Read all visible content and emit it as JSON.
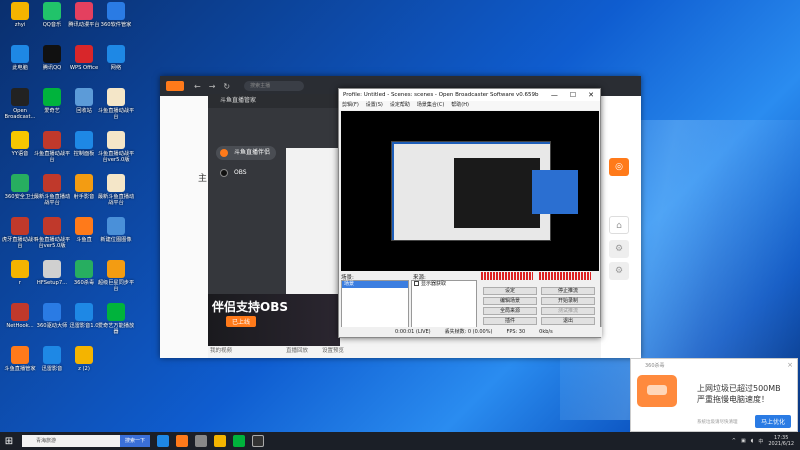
{
  "desktop_icons": [
    {
      "label": "zhyi",
      "color": "#f4b400",
      "icon": "folder-icon"
    },
    {
      "label": "QQ音乐",
      "color": "#21c36a",
      "icon": "music-icon"
    },
    {
      "label": "腾讯动漫平台",
      "color": "#e4405f",
      "icon": "app-icon"
    },
    {
      "label": "360软件管家",
      "color": "#2a7be4",
      "icon": "app-icon"
    },
    {
      "label": "此电脑",
      "color": "#1e88e5",
      "icon": "pc-icon"
    },
    {
      "label": "腾讯QQ",
      "color": "#111",
      "icon": "qq-icon"
    },
    {
      "label": "WPS Office",
      "color": "#d8262a",
      "icon": "wps-icon"
    },
    {
      "label": "网络",
      "color": "#1e88e5",
      "icon": "network-icon"
    },
    {
      "label": "Open Broadcast...",
      "color": "#222",
      "icon": "obs-icon"
    },
    {
      "label": "爱奇艺",
      "color": "#00b33c",
      "icon": "iqiyi-icon"
    },
    {
      "label": "回收站",
      "color": "#5c9bd8",
      "icon": "recycle-icon"
    },
    {
      "label": "斗鱼直播动战平台",
      "color": "#f4e6c8",
      "icon": "doc-icon"
    },
    {
      "label": "YY语音",
      "color": "#f6c700",
      "icon": "yy-icon"
    },
    {
      "label": "斗鱼直播动战平台",
      "color": "#c0392b",
      "icon": "archive-icon"
    },
    {
      "label": "控制面板",
      "color": "#1e88e5",
      "icon": "control-icon"
    },
    {
      "label": "斗鱼直播动战平台ver5.0版",
      "color": "#f4e6c8",
      "icon": "doc-icon"
    },
    {
      "label": "360安全卫士",
      "color": "#27ae60",
      "icon": "shield-icon"
    },
    {
      "label": "最新斗鱼直播动战平台",
      "color": "#c0392b",
      "icon": "archive-icon"
    },
    {
      "label": "射手影音",
      "color": "#f39c12",
      "icon": "player-icon"
    },
    {
      "label": "最新斗鱼直播动战平台",
      "color": "#f4e6c8",
      "icon": "doc-icon"
    },
    {
      "label": "虎牙直播动战平台",
      "color": "#c0392b",
      "icon": "archive-icon"
    },
    {
      "label": "斗鱼直播动战平台ver5.0版",
      "color": "#c0392b",
      "icon": "archive-icon"
    },
    {
      "label": "斗鱼直",
      "color": "#ff7a1a",
      "icon": "douyu-icon"
    },
    {
      "label": "新建位图图像",
      "color": "#4a90d9",
      "icon": "image-icon"
    },
    {
      "label": "r",
      "color": "#f4b400",
      "icon": "app-icon"
    },
    {
      "label": "HFSetup7...",
      "color": "#d0d0d0",
      "icon": "setup-icon"
    },
    {
      "label": "360杀毒",
      "color": "#27ae60",
      "icon": "antivirus-icon"
    },
    {
      "label": "超级巨星同步平台",
      "color": "#f39c12",
      "icon": "app-icon"
    },
    {
      "label": "NetHook...",
      "color": "#c0392b",
      "icon": "app-icon"
    },
    {
      "label": "360驱动大师",
      "color": "#2a7be4",
      "icon": "driver-icon"
    },
    {
      "label": "迅雷影音1.0",
      "color": "#1e88e5",
      "icon": "xunlei-icon"
    },
    {
      "label": "爱奇艺万能播放器",
      "color": "#00b33c",
      "icon": "iqiyi-icon"
    },
    {
      "label": "斗鱼直播管家",
      "color": "#ff7a1a",
      "icon": "douyu-icon"
    },
    {
      "label": "迅雷影音",
      "color": "#1e88e5",
      "icon": "xunlei-icon"
    },
    {
      "label": "z (2)",
      "color": "#f4b400",
      "icon": "app-icon"
    }
  ],
  "douyu": {
    "nav_back": "←",
    "nav_fwd": "→",
    "nav_refresh": "↻",
    "search_placeholder": "搜索主播",
    "main_char": "主"
  },
  "assistant": {
    "title": "斗鱼直播管家",
    "menu1": "斗鱼直播伴侣",
    "menu2": "OBS",
    "banner_title": "伴侣支持OBS",
    "banner_btn": "已上线",
    "bottom1": "我的视频",
    "bottom2": "直播回放",
    "bottom3": "设置预览"
  },
  "obs": {
    "title": "Profile: Untitled - Scenes: scenes - Open Broadcaster Software v0.659b",
    "min": "—",
    "max": "☐",
    "close": "✕",
    "menu": [
      "剪辑(F)",
      "设置(S)",
      "设定帮助",
      "场景集合(C)",
      "帮助(H)"
    ],
    "scenes_label": "场景:",
    "sources_label": "来源:",
    "scene_item": "场景",
    "source_item": "显示器获取",
    "btn_settings": "设定",
    "btn_stop": "停止推流",
    "btn_edit_scene": "编辑场景",
    "btn_record": "开始录制",
    "btn_global": "全局来源",
    "btn_test": "测试推流",
    "btn_plugins": "插件",
    "btn_exit": "退出",
    "status_time": "0:00:01 (LIVE)",
    "status_drop": "丢失帧数: 0 (0.00%)",
    "status_fps": "FPS: 30",
    "status_kbps": "0kb/s"
  },
  "notify": {
    "app": "360杀毒",
    "line1": "上网垃圾已超过500MB",
    "line2": "严重拖慢电脑速度！",
    "more": "系统垃圾请尽快清理",
    "button": "马上优化",
    "close": "×"
  },
  "taskbar": {
    "start": "⊞",
    "search": "青海旅游",
    "baidu": "搜索一下",
    "time": "17:35",
    "date": "2021/6/12",
    "lang": "中"
  }
}
